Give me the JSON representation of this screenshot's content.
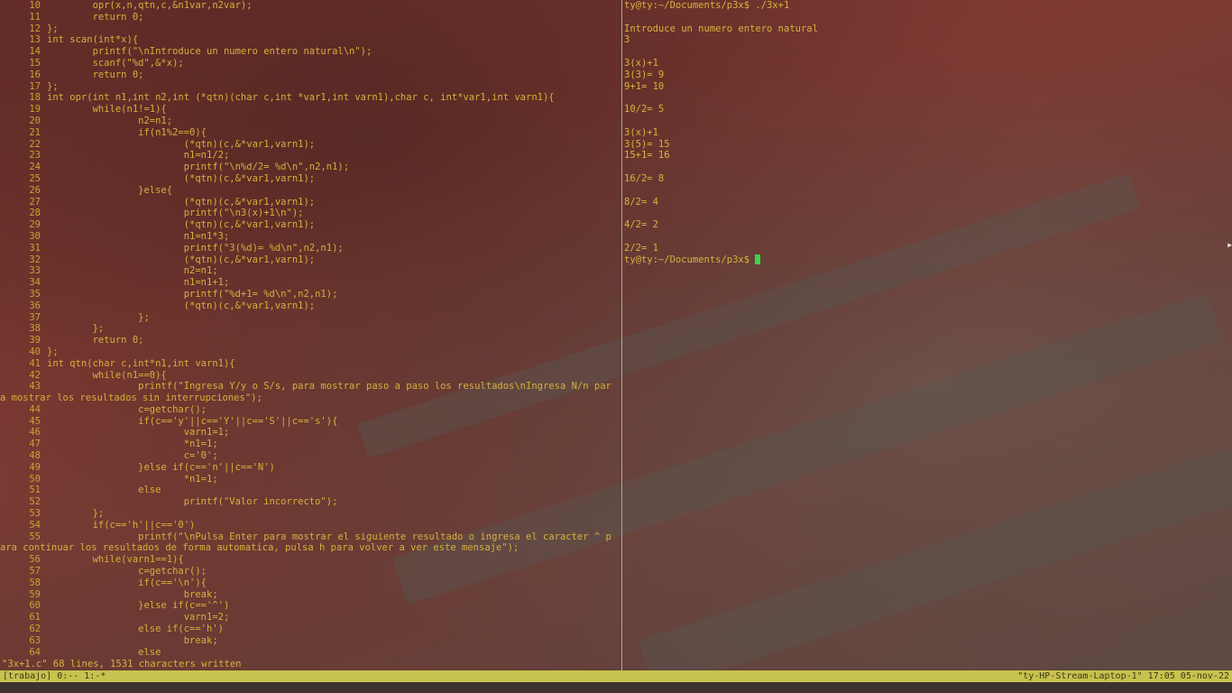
{
  "editor": {
    "lines": [
      {
        "n": "10",
        "text": "        opr(x,n,qtn,c,&n1var,n2var);"
      },
      {
        "n": "11",
        "text": "        return 0;"
      },
      {
        "n": "12",
        "text": "};"
      },
      {
        "n": "13",
        "text": "int scan(int*x){"
      },
      {
        "n": "14",
        "text": "        printf(\"\\nIntroduce un numero entero natural\\n\");"
      },
      {
        "n": "15",
        "text": "        scanf(\"%d\",&*x);"
      },
      {
        "n": "16",
        "text": "        return 0;"
      },
      {
        "n": "17",
        "text": "};"
      },
      {
        "n": "18",
        "text": "int opr(int n1,int n2,int (*qtn)(char c,int *var1,int varn1),char c, int*var1,int varn1){"
      },
      {
        "n": "19",
        "text": "        while(n1!=1){"
      },
      {
        "n": "20",
        "text": "                n2=n1;"
      },
      {
        "n": "21",
        "text": "                if(n1%2==0){"
      },
      {
        "n": "22",
        "text": "                        (*qtn)(c,&*var1,varn1);"
      },
      {
        "n": "23",
        "text": "                        n1=n1/2;"
      },
      {
        "n": "24",
        "text": "                        printf(\"\\n%d/2= %d\\n\",n2,n1);"
      },
      {
        "n": "25",
        "text": "                        (*qtn)(c,&*var1,varn1);"
      },
      {
        "n": "26",
        "text": "                }else{"
      },
      {
        "n": "27",
        "text": "                        (*qtn)(c,&*var1,varn1);"
      },
      {
        "n": "28",
        "text": "                        printf(\"\\n3(x)+1\\n\");"
      },
      {
        "n": "29",
        "text": "                        (*qtn)(c,&*var1,varn1);"
      },
      {
        "n": "30",
        "text": "                        n1=n1*3;"
      },
      {
        "n": "31",
        "text": "                        printf(\"3(%d)= %d\\n\",n2,n1);"
      },
      {
        "n": "32",
        "text": "                        (*qtn)(c,&*var1,varn1);"
      },
      {
        "n": "33",
        "text": "                        n2=n1;"
      },
      {
        "n": "34",
        "text": "                        n1=n1+1;"
      },
      {
        "n": "35",
        "text": "                        printf(\"%d+1= %d\\n\",n2,n1);"
      },
      {
        "n": "36",
        "text": "                        (*qtn)(c,&*var1,varn1);"
      },
      {
        "n": "37",
        "text": "                };"
      },
      {
        "n": "38",
        "text": "        };"
      },
      {
        "n": "39",
        "text": "        return 0;"
      },
      {
        "n": "40",
        "text": "};"
      },
      {
        "n": "41",
        "text": "int qtn(char c,int*n1,int varn1){"
      },
      {
        "n": "42",
        "text": "        while(n1==0){"
      },
      {
        "n": "43",
        "text": "                printf(\"Ingresa Y/y o S/s, para mostrar paso a paso los resultados\\nIngresa N/n par"
      },
      {
        "n": "",
        "text": "a mostrar los resultados sin interrupciones\");"
      },
      {
        "n": "44",
        "text": "                c=getchar();"
      },
      {
        "n": "45",
        "text": "                if(c=='y'||c=='Y'||c=='S'||c=='s'){"
      },
      {
        "n": "46",
        "text": "                        varn1=1;"
      },
      {
        "n": "47",
        "text": "                        *n1=1;"
      },
      {
        "n": "48",
        "text": "                        c='0';"
      },
      {
        "n": "49",
        "text": "                }else if(c=='n'||c=='N')"
      },
      {
        "n": "50",
        "text": "                        *n1=1;"
      },
      {
        "n": "51",
        "text": "                else"
      },
      {
        "n": "52",
        "text": "                        printf(\"Valor incorrecto\");"
      },
      {
        "n": "53",
        "text": "        };"
      },
      {
        "n": "54",
        "text": "        if(c=='h'||c=='0')"
      },
      {
        "n": "55",
        "text": "                printf(\"\\nPulsa Enter para mostrar el siguiente resultado o ingresa el caracter ^ p"
      },
      {
        "n": "",
        "text": "ara continuar los resultados de forma automatica, pulsa h para volver a ver este mensaje\");"
      },
      {
        "n": "56",
        "text": "        while(varn1==1){"
      },
      {
        "n": "57",
        "text": "                c=getchar();"
      },
      {
        "n": "58",
        "text": "                if(c=='\\n'){"
      },
      {
        "n": "59",
        "text": "                        break;"
      },
      {
        "n": "60",
        "text": "                }else if(c=='^')"
      },
      {
        "n": "61",
        "text": "                        varn1=2;"
      },
      {
        "n": "62",
        "text": "                else if(c=='h')"
      },
      {
        "n": "63",
        "text": "                        break;"
      },
      {
        "n": "64",
        "text": "                else"
      }
    ],
    "message": "\"3x+1.c\" 68 lines, 1531 characters written"
  },
  "terminal": {
    "lines": [
      "ty@ty:~/Documents/p3x$ ./3x+1",
      "",
      "Introduce un numero entero natural",
      "3",
      "",
      "3(x)+1",
      "3(3)= 9",
      "9+1= 10",
      "",
      "10/2= 5",
      "",
      "3(x)+1",
      "3(5)= 15",
      "15+1= 16",
      "",
      "16/2= 8",
      "",
      "8/2= 4",
      "",
      "4/2= 2",
      "",
      "2/2= 1"
    ],
    "prompt": "ty@ty:~/Documents/p3x$ "
  },
  "statusbar": {
    "left": "[trabajo] 0:-- 1:-*",
    "right": "\"ty-HP-Stream-Laptop-1\" 17:05 05-nov-22"
  },
  "colors": {
    "text": "#d9b23c",
    "statusbar_bg": "#c8c24e",
    "cursor": "#3cd24a"
  }
}
